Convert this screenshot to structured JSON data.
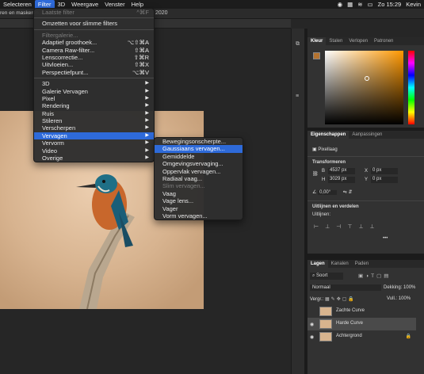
{
  "menubar": {
    "items": [
      "Selecteren",
      "Filter",
      "3D",
      "Weergave",
      "Venster",
      "Help"
    ],
    "status_time": "Zo 15:29",
    "status_user": "Kevin"
  },
  "options_bar": {
    "text": "ren en maskeren..."
  },
  "document": {
    "tab_fragment": "2020"
  },
  "filter_menu": {
    "items": [
      {
        "label": "Laatste filter",
        "shortcut": "^⌘F",
        "disabled": true
      },
      {
        "sep": true
      },
      {
        "label": "Omzetten voor slimme filters"
      },
      {
        "sep": true
      },
      {
        "label": "Filtergalerie...",
        "disabled": true
      },
      {
        "label": "Adaptief groothoek...",
        "shortcut": "⌥⇧⌘A"
      },
      {
        "label": "Camera Raw-filter...",
        "shortcut": "⇧⌘A"
      },
      {
        "label": "Lenscorrectie...",
        "shortcut": "⇧⌘R"
      },
      {
        "label": "Uitvloeien...",
        "shortcut": "⇧⌘X"
      },
      {
        "label": "Perspectiefpunt...",
        "shortcut": "⌥⌘V"
      },
      {
        "sep": true
      },
      {
        "label": "3D",
        "submenu": true
      },
      {
        "label": "Galerie Vervagen",
        "submenu": true
      },
      {
        "label": "Pixel",
        "submenu": true
      },
      {
        "label": "Rendering",
        "submenu": true
      },
      {
        "label": "Ruis",
        "submenu": true
      },
      {
        "label": "Stileren",
        "submenu": true
      },
      {
        "label": "Verscherpen",
        "submenu": true
      },
      {
        "label": "Vervagen",
        "submenu": true,
        "highlighted": true
      },
      {
        "label": "Vervorm",
        "submenu": true
      },
      {
        "label": "Video",
        "submenu": true
      },
      {
        "label": "Overige",
        "submenu": true
      }
    ]
  },
  "blur_submenu": {
    "items": [
      {
        "label": "Bewegingsonscherpte..."
      },
      {
        "label": "Gaussiaans vervagen...",
        "highlighted": true
      },
      {
        "label": "Gemiddelde"
      },
      {
        "label": "Omgevingsvervaging..."
      },
      {
        "label": "Oppervlak vervagen..."
      },
      {
        "label": "Radiaal vaag..."
      },
      {
        "label": "Slim vervagen...",
        "disabled": true
      },
      {
        "label": "Vaag"
      },
      {
        "label": "Vage lens..."
      },
      {
        "label": "Vager"
      },
      {
        "label": "Vorm vervagen..."
      }
    ]
  },
  "color_panel": {
    "tabs": [
      "Kleur",
      "Stalen",
      "Verlopen",
      "Patronen"
    ],
    "foreground": "#b5732f",
    "background": "#000000"
  },
  "properties_panel": {
    "tabs": [
      "Eigenschappen",
      "Aanpassingen"
    ],
    "layer_type": "Pixellaag",
    "transform_title": "Transformeren",
    "w_label": "B",
    "w_value": "4537 px",
    "h_label": "H",
    "h_value": "3029 px",
    "x_label": "X",
    "x_value": "0 px",
    "y_label": "Y",
    "y_value": "0 px",
    "angle": "0,00°",
    "align_title": "Uitlijnen en verdelen",
    "align_sub": "Uitlijnen:",
    "more": "•••"
  },
  "layers_panel": {
    "tabs": [
      "Lagen",
      "Kanalen",
      "Paden"
    ],
    "search": "Soort",
    "blend_mode": "Normaal",
    "opacity_label": "Dekking:",
    "opacity_value": "100%",
    "lock_label": "Vergr.:",
    "fill_label": "Vull.:",
    "fill_value": "100%",
    "layers": [
      {
        "name": "Zachte Curve",
        "visible": false
      },
      {
        "name": "Harde Curve",
        "visible": true,
        "selected": true
      },
      {
        "name": "Achtergrond",
        "visible": true,
        "locked": true
      }
    ]
  }
}
